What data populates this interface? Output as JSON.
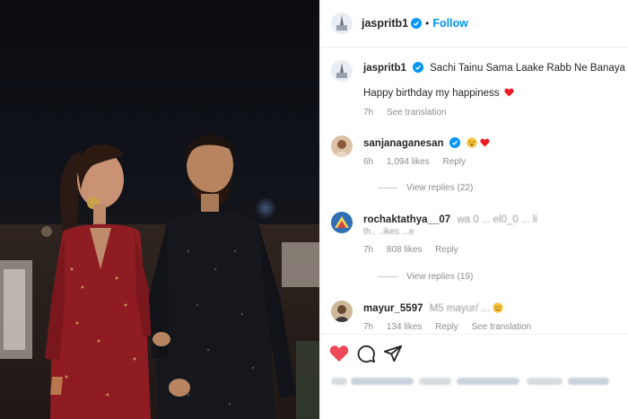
{
  "post": {
    "author": "jasprit",
    "follow_label": "Follow",
    "caption": "Sachi Tainu Sama Laake Rabb Ne Banaya",
    "caption_line2": "Happy birthday my happiness",
    "caption_time": "7h",
    "see_translation": "See translation"
  },
  "header": {
    "username": "jaspritb1",
    "separator": "•",
    "follow_label": "Follow"
  },
  "comments": [
    {
      "username": "sanjanaganesan",
      "text": "",
      "time": "6h",
      "likes": "1,094 likes",
      "reply": "Reply",
      "view_replies": "View replies (22)"
    },
    {
      "username": "rochaktathya__07",
      "text": "wa  0  ...  el0_0  ...  li",
      "text2": "th.. ..ikes ...e",
      "time": "7h",
      "likes": "808 likes",
      "reply": "Reply",
      "view_replies": "View replies (19)"
    },
    {
      "username": "mayur_5597",
      "text": "M5   mayur/ ...",
      "time": "7h",
      "likes": "134 likes",
      "reply": "Reply",
      "see_translation": "See translation"
    }
  ],
  "caption_block": {
    "username": "jaspritb1",
    "line1": "Sachi Tainu Sama Laake Rabb Ne Banaya",
    "line2": "Happy birthday my happiness",
    "time": "7h",
    "see_translation": "See translation"
  },
  "icons": [
    "heart-icon",
    "comment-icon",
    "share-icon",
    "verified-icon"
  ],
  "colors": {
    "accent": "#0095f6",
    "heart": "#ed4956",
    "dress_red": "#8e1c22",
    "text": "#262626",
    "muted": "#8e8e8e"
  }
}
